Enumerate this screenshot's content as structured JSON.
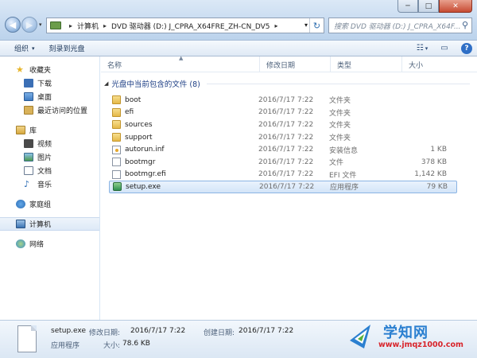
{
  "window": {
    "min_glyph": "─",
    "max_glyph": "□",
    "close_glyph": "✕"
  },
  "address_bar": {
    "crumbs": [
      "计算机",
      "DVD 驱动器 (D:) J_CPRA_X64FRE_ZH-CN_DV5"
    ],
    "separator": "▸",
    "dropdown": "▾",
    "refresh": "↻"
  },
  "search": {
    "placeholder": "搜索 DVD 驱动器 (D:) J_CPRA_X64F...",
    "icon": "search-icon"
  },
  "toolbar": {
    "organize": "组织",
    "organize_caret": "▾",
    "burn": "刻录到光盘",
    "view_icon": "☷",
    "view_caret": "▾",
    "pane_icon": "▭",
    "help": "?"
  },
  "sidebar": {
    "favorites": {
      "label": "收藏夹",
      "items": [
        "下载",
        "桌面",
        "最近访问的位置"
      ]
    },
    "libraries": {
      "label": "库",
      "items": [
        "视频",
        "图片",
        "文档",
        "音乐"
      ]
    },
    "homegroup": "家庭组",
    "computer": "计算机",
    "network": "网络"
  },
  "columns": {
    "name": "名称",
    "date": "修改日期",
    "type": "类型",
    "size": "大小"
  },
  "group": {
    "label": "光盘中当前包含的文件 (8)"
  },
  "files": [
    {
      "name": "boot",
      "date": "2016/7/17 7:22",
      "type": "文件夹",
      "size": "",
      "icon": "folder"
    },
    {
      "name": "efi",
      "date": "2016/7/17 7:22",
      "type": "文件夹",
      "size": "",
      "icon": "folder"
    },
    {
      "name": "sources",
      "date": "2016/7/17 7:22",
      "type": "文件夹",
      "size": "",
      "icon": "folder"
    },
    {
      "name": "support",
      "date": "2016/7/17 7:22",
      "type": "文件夹",
      "size": "",
      "icon": "folder"
    },
    {
      "name": "autorun.inf",
      "date": "2016/7/17 7:22",
      "type": "安装信息",
      "size": "1 KB",
      "icon": "inf"
    },
    {
      "name": "bootmgr",
      "date": "2016/7/17 7:22",
      "type": "文件",
      "size": "378 KB",
      "icon": "file"
    },
    {
      "name": "bootmgr.efi",
      "date": "2016/7/17 7:22",
      "type": "EFI 文件",
      "size": "1,142 KB",
      "icon": "file"
    },
    {
      "name": "setup.exe",
      "date": "2016/7/17 7:22",
      "type": "应用程序",
      "size": "79 KB",
      "icon": "exe",
      "selected": true
    }
  ],
  "details": {
    "name": "setup.exe",
    "type": "应用程序",
    "modified_label": "修改日期:",
    "modified_value": "2016/7/17 7:22",
    "created_label": "创建日期:",
    "created_value": "2016/7/17 7:22",
    "size_label": "大小:",
    "size_value": "78.6 KB"
  },
  "watermark": {
    "title": "学知网",
    "url": "www.jmqz1000.com"
  }
}
